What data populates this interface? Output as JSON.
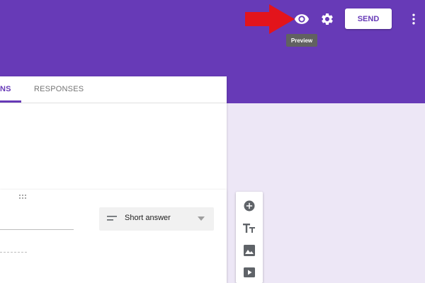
{
  "header": {
    "preview_tooltip": "Preview",
    "send_label": "SEND",
    "color": "#673ab7"
  },
  "tabs": [
    {
      "label": "QUESTIONS",
      "visible_text": "NS",
      "active": true
    },
    {
      "label": "RESPONSES",
      "active": false
    }
  ],
  "question": {
    "type_label": "Short answer"
  },
  "toolbar": {
    "items": [
      "add-question-icon",
      "title-text-icon",
      "image-icon",
      "video-icon"
    ]
  },
  "annotation": {
    "arrow_color": "#e3141b",
    "points_to": "preview-icon"
  },
  "colors": {
    "accent": "#673ab7",
    "background": "#ede7f6",
    "icon_gray": "#5f6368"
  }
}
